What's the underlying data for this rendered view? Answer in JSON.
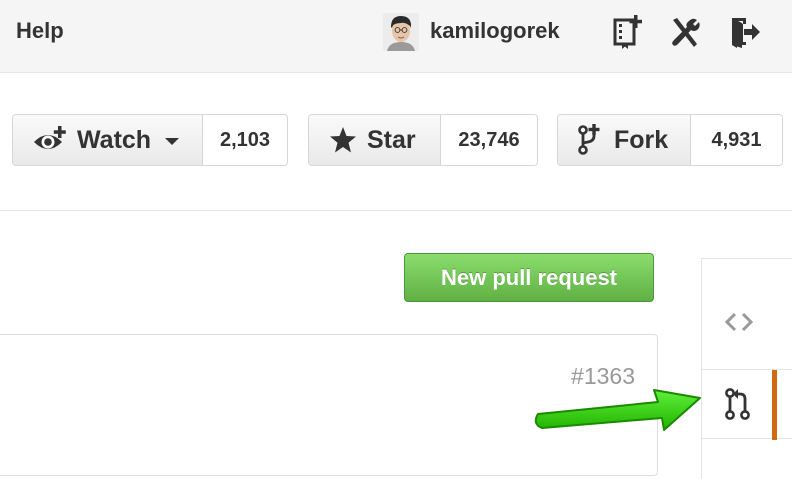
{
  "header": {
    "help_label": "Help",
    "username": "kamilogorek",
    "icons": [
      "new-repo-icon",
      "settings-icon",
      "sign-out-icon"
    ]
  },
  "actions": {
    "watch": {
      "label": "Watch",
      "count": "2,103",
      "icon": "eye-icon"
    },
    "star": {
      "label": "Star",
      "count": "23,746",
      "icon": "star-icon"
    },
    "fork": {
      "label": "Fork",
      "count": "4,931",
      "icon": "fork-icon"
    }
  },
  "pulls": {
    "new_button_label": "New pull request",
    "first_item_number": "#1363"
  },
  "repo_nav": {
    "items": [
      {
        "icon": "code-icon",
        "active": false
      },
      {
        "icon": "pull-request-icon",
        "active": true
      }
    ]
  },
  "colors": {
    "primary_green": "#6cc644",
    "active_tab_bar": "#d26911",
    "annotation_arrow": "#33cc00"
  }
}
